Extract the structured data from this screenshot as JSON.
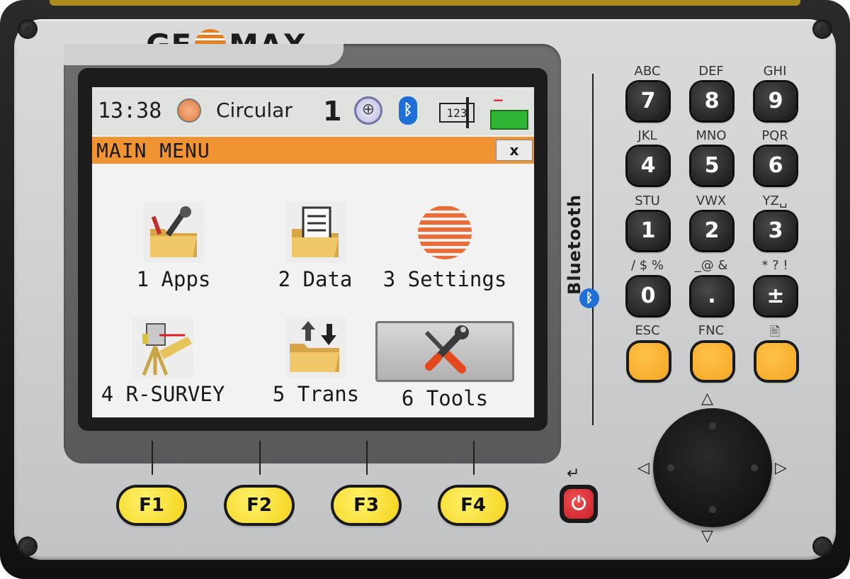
{
  "brand": {
    "left": "GE",
    "right": "MAX"
  },
  "status": {
    "time": "13:38",
    "mode": "Circular",
    "face_number": "1",
    "target_icon": "crosshair-target",
    "bluetooth_icon": "bluetooth",
    "input_mode": "123",
    "battery_signs": "−+"
  },
  "menu": {
    "title": "MAIN MENU",
    "close_label": "x",
    "items": [
      {
        "label": "1 Apps",
        "icon": "apps-folder-tools"
      },
      {
        "label": "2 Data",
        "icon": "data-folder-document"
      },
      {
        "label": "3 Settings",
        "icon": "geomax-globe"
      },
      {
        "label": "4 R-SURVEY",
        "icon": "total-station-folder"
      },
      {
        "label": "5 Trans",
        "icon": "transfer-folder-arrows"
      },
      {
        "label": "6 Tools",
        "icon": "wrench-screwdriver",
        "selected": true
      }
    ]
  },
  "side_label": "Bluetooth",
  "keypad": {
    "rows": [
      [
        {
          "sub": "ABC",
          "key": "7"
        },
        {
          "sub": "DEF",
          "key": "8"
        },
        {
          "sub": "GHI",
          "key": "9"
        }
      ],
      [
        {
          "sub": "JKL",
          "key": "4"
        },
        {
          "sub": "MNO",
          "key": "5"
        },
        {
          "sub": "PQR",
          "key": "6"
        }
      ],
      [
        {
          "sub": "STU",
          "key": "1"
        },
        {
          "sub": "VWX",
          "key": "2"
        },
        {
          "sub": "YZ␣",
          "key": "3"
        }
      ],
      [
        {
          "sub": "/ $ %",
          "key": "0"
        },
        {
          "sub": "_@ &",
          "key": "."
        },
        {
          "sub": "* ? !",
          "key": "±"
        }
      ]
    ],
    "function_keys": [
      {
        "label": "ESC"
      },
      {
        "label": "FNC"
      },
      {
        "label": "🖹"
      }
    ]
  },
  "softkeys": [
    "F1",
    "F2",
    "F3",
    "F4"
  ],
  "power_symbol": "⏻",
  "enter_symbol": "↵",
  "colors": {
    "accent": "#f09333",
    "softkey": "#f3d21a",
    "orange_key": "#f5a623",
    "power": "#d8232a",
    "bluetooth": "#1f6fd6"
  }
}
